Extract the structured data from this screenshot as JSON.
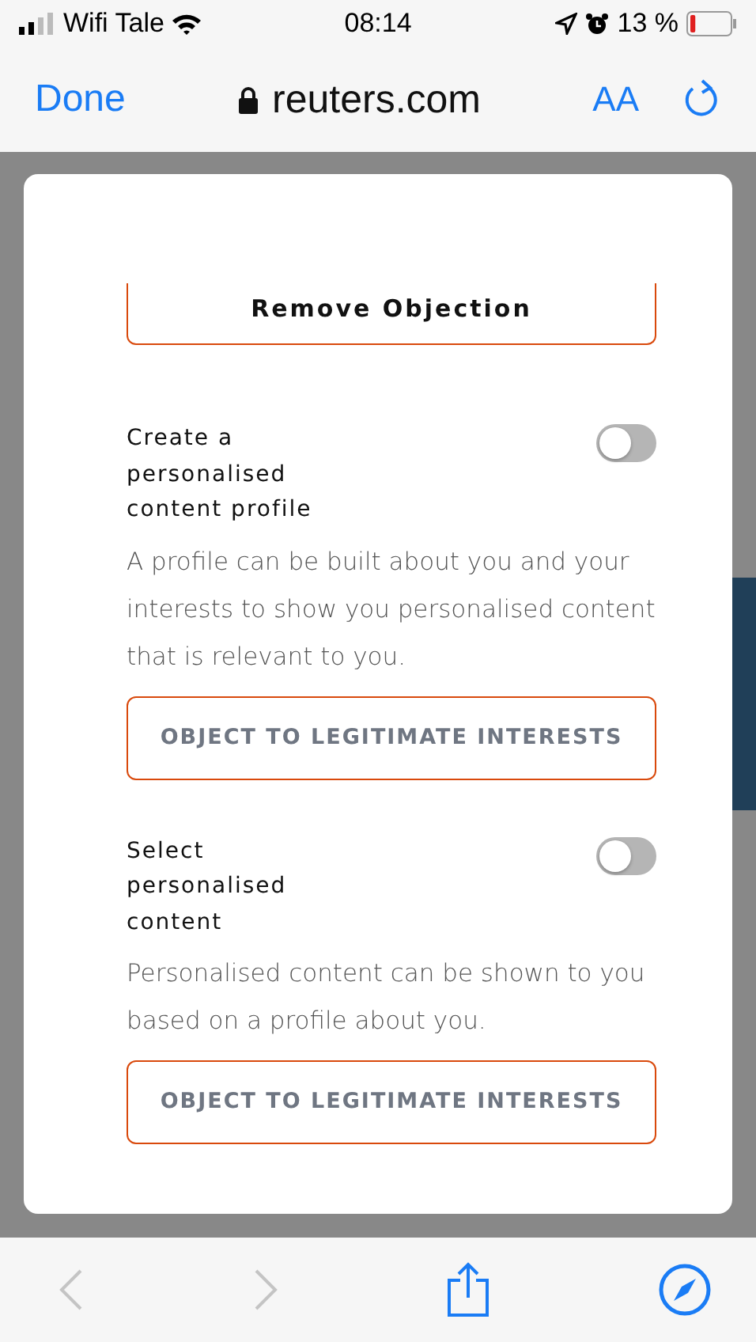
{
  "status_bar": {
    "carrier": "Wifi Tale",
    "time": "08:14",
    "battery": "13 %"
  },
  "browser_bar": {
    "done": "Done",
    "domain": "reuters.com",
    "text_size": "AA"
  },
  "dialog": {
    "remove_button": "Remove Objection",
    "purposes": [
      {
        "title": "Create a personalised content profile",
        "description": "A profile can be built about you and your interests to show you personalised content that is relevant to you.",
        "on": false,
        "button": "OBJECT TO LEGITIMATE INTERESTS"
      },
      {
        "title": "Select personalised content",
        "description": "Personalised content can be shown to you based on a profile about you.",
        "on": false,
        "button": "OBJECT TO LEGITIMATE INTERESTS"
      }
    ]
  }
}
